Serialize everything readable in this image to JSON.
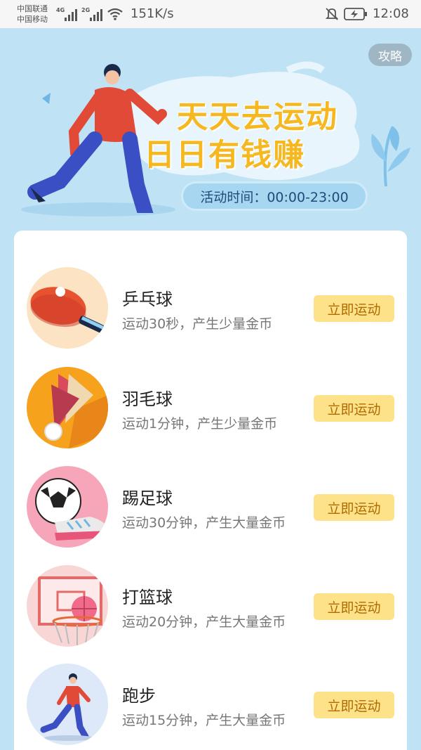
{
  "status_bar": {
    "carrier1": "中国联通",
    "carrier2": "中国移动",
    "net1": "4G",
    "net2": "2G",
    "speed": "151K/s",
    "time": "12:08"
  },
  "hero": {
    "guide_label": "攻略",
    "slogan_line1": "天天去运动",
    "slogan_line2": "日日有钱赚",
    "activity_time": "活动时间：00:00-23:00"
  },
  "sports": [
    {
      "name": "乒乓球",
      "desc": "运动30秒，产生少量金币",
      "button": "立即运动",
      "icon": "ping-pong-icon"
    },
    {
      "name": "羽毛球",
      "desc": "运动1分钟，产生少量金币",
      "button": "立即运动",
      "icon": "badminton-icon"
    },
    {
      "name": "踢足球",
      "desc": "运动30分钟，产生大量金币",
      "button": "立即运动",
      "icon": "soccer-icon"
    },
    {
      "name": "打篮球",
      "desc": "运动20分钟，产生大量金币",
      "button": "立即运动",
      "icon": "basketball-icon"
    },
    {
      "name": "跑步",
      "desc": "运动15分钟，产生大量金币",
      "button": "立即运动",
      "icon": "running-icon"
    }
  ],
  "colors": {
    "background": "#bfe3f5",
    "slogan": "#f6b820",
    "button_bg": "#fde28a",
    "button_text": "#b06a00"
  }
}
